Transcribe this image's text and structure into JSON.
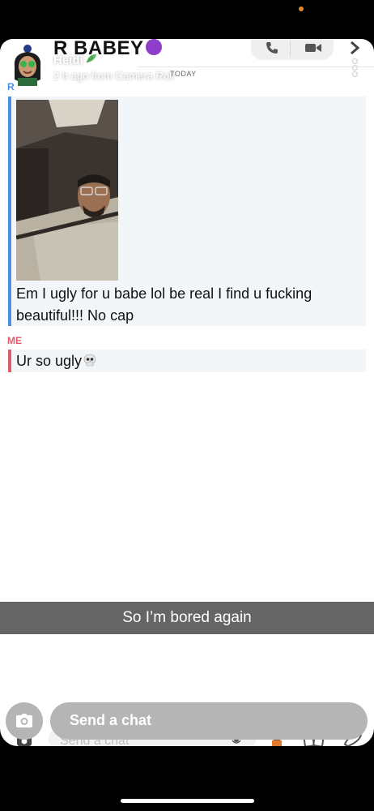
{
  "header": {
    "title": "R BABEY",
    "subtitle": "Heidi",
    "time_info": "2 h ago from Camera Roll",
    "today_tag": "TODAY"
  },
  "messages": [
    {
      "sender": "R",
      "sender_color": "#4a90e2",
      "text": "Em I ugly for u babe lol be real I find u fucking beautiful!!! No cap"
    },
    {
      "sender": "ME",
      "sender_color": "#e05a6c",
      "text": "Ur so ugly"
    }
  ],
  "caption": "So I’m bored again",
  "composer": {
    "placeholder": "Send a chat",
    "ghost_placeholder": "Send a chat"
  },
  "icons": [
    "avatar",
    "devil-emoji-icon",
    "leaf-emoji-icon",
    "phone-icon",
    "video-icon",
    "chevron-right-icon",
    "more-icon",
    "skull-emoji-icon",
    "camera-icon",
    "mic-icon",
    "bitmoji-icon",
    "sticker-icon",
    "rocket-icon"
  ],
  "colors": {
    "accent_friend": "#4a90e2",
    "accent_me": "#e05a6c",
    "bubble_bg": "#f3f6f9"
  }
}
